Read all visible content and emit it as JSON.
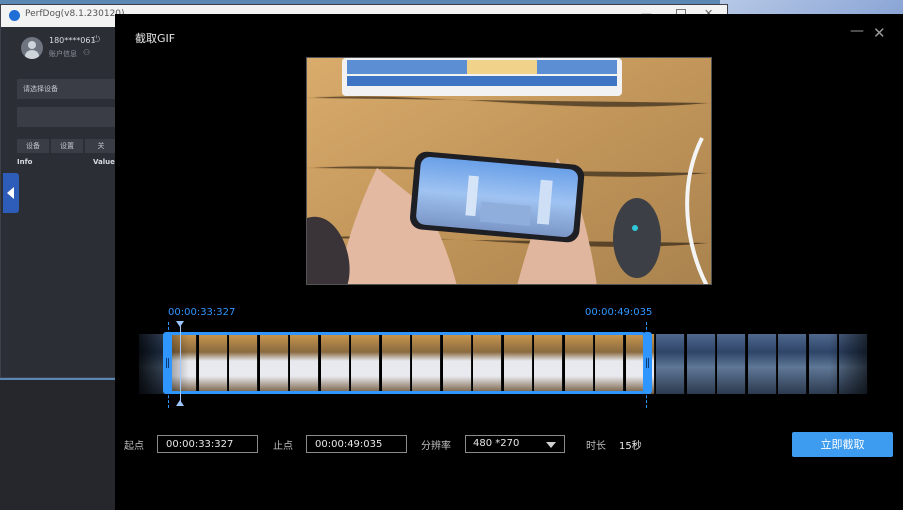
{
  "background_window": {
    "title": "PerfDog(v8.1.230120)",
    "user": "180****061",
    "account_label": "账户信息",
    "device_placeholder": "请选择设备",
    "tabs": [
      "设备",
      "设置",
      "关"
    ],
    "columns": [
      "Info",
      "Value"
    ]
  },
  "dialog": {
    "title": "截取GIF",
    "start_marker": "00:00:33:327",
    "end_marker": "00:00:49:035",
    "start_label": "起点",
    "start_value": "00:00:33:327",
    "end_label": "止点",
    "end_value": "00:00:49:035",
    "resolution_label": "分辨率",
    "resolution_value": "480 *270",
    "duration_label": "时长",
    "duration_value": "15秒",
    "capture_button": "立即截取"
  },
  "colors": {
    "accent": "#2f95ff",
    "button": "#3d9bf0",
    "dialog_bg": "#000000"
  }
}
